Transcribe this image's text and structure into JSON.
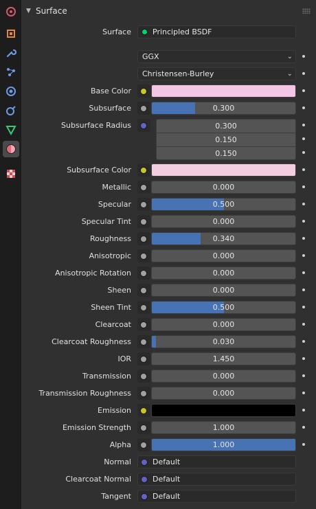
{
  "panel": {
    "title": "Surface"
  },
  "tabs": [
    {
      "name": "render-tab-icon"
    },
    {
      "name": "object-tab-icon"
    },
    {
      "name": "modifier-tab-icon"
    },
    {
      "name": "particles-tab-icon"
    },
    {
      "name": "physics-tab-icon"
    },
    {
      "name": "constraints-tab-icon"
    },
    {
      "name": "data-tab-icon"
    },
    {
      "name": "material-tab-icon"
    },
    {
      "name": "texture-tab-icon"
    }
  ],
  "surface": {
    "label": "Surface",
    "value": "Principled BSDF"
  },
  "distribution": {
    "value": "GGX"
  },
  "subsurface_method": {
    "value": "Christensen-Burley"
  },
  "base_color": {
    "label": "Base Color",
    "color": "#f3c6e6"
  },
  "subsurface": {
    "label": "Subsurface",
    "value": "0.300",
    "fraction": 0.3
  },
  "subsurface_radius": {
    "label": "Subsurface Radius",
    "values": [
      "0.300",
      "0.150",
      "0.150"
    ]
  },
  "subsurface_color": {
    "label": "Subsurface Color",
    "color": "#f3cde0"
  },
  "sliders": [
    {
      "label": "Metallic",
      "value": "0.000",
      "fraction": 0.0
    },
    {
      "label": "Specular",
      "value": "0.500",
      "fraction": 0.5
    },
    {
      "label": "Specular Tint",
      "value": "0.000",
      "fraction": 0.0
    },
    {
      "label": "Roughness",
      "value": "0.340",
      "fraction": 0.34
    },
    {
      "label": "Anisotropic",
      "value": "0.000",
      "fraction": 0.0
    },
    {
      "label": "Anisotropic Rotation",
      "value": "0.000",
      "fraction": 0.0
    },
    {
      "label": "Sheen",
      "value": "0.000",
      "fraction": 0.0
    },
    {
      "label": "Sheen Tint",
      "value": "0.500",
      "fraction": 0.5
    },
    {
      "label": "Clearcoat",
      "value": "0.000",
      "fraction": 0.0
    },
    {
      "label": "Clearcoat Roughness",
      "value": "0.030",
      "fraction": 0.03
    },
    {
      "label": "IOR",
      "value": "1.450",
      "fraction": 0.0
    },
    {
      "label": "Transmission",
      "value": "0.000",
      "fraction": 0.0
    },
    {
      "label": "Transmission Roughness",
      "value": "0.000",
      "fraction": 0.0
    }
  ],
  "emission": {
    "label": "Emission",
    "color": "#000000"
  },
  "emission_strength": {
    "label": "Emission Strength",
    "value": "1.000",
    "fraction": 0.0
  },
  "alpha": {
    "label": "Alpha",
    "value": "1.000",
    "fraction": 1.0
  },
  "links": [
    {
      "label": "Normal",
      "value": "Default"
    },
    {
      "label": "Clearcoat Normal",
      "value": "Default"
    },
    {
      "label": "Tangent",
      "value": "Default"
    }
  ],
  "colors": {
    "slider_fill": "#4772b3",
    "socket_gray": "#a1a1a1",
    "socket_yellow": "#c7c729",
    "socket_blue": "#6363c7",
    "socket_green": "#00d66b"
  }
}
